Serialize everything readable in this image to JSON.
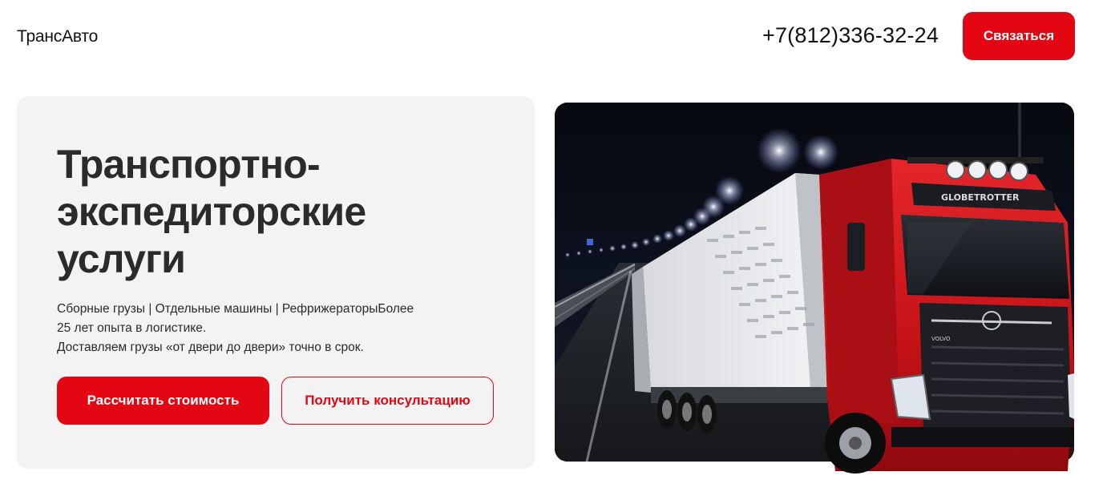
{
  "header": {
    "logo": "ТрансАвто",
    "phone": "+7(812)336-32-24",
    "contact_label": "Связаться"
  },
  "hero": {
    "title": "Транспортно-экспедиторские услуги",
    "description_line1": "Сборные грузы | Отдельные машины | РефрижераторыБолее",
    "description_line2": "25 лет опыта в логистике.",
    "description_line3": "Доставляем грузы «от двери до двери» точно в срок.",
    "primary_button": "Рассчитать стоимость",
    "secondary_button": "Получить консультацию",
    "truck_visor_text": "GLOBETROTTER",
    "truck_brand": "VOLVO"
  },
  "colors": {
    "accent": "#e30613",
    "card_bg": "#f3f3f3",
    "text": "#2b2b2b"
  }
}
